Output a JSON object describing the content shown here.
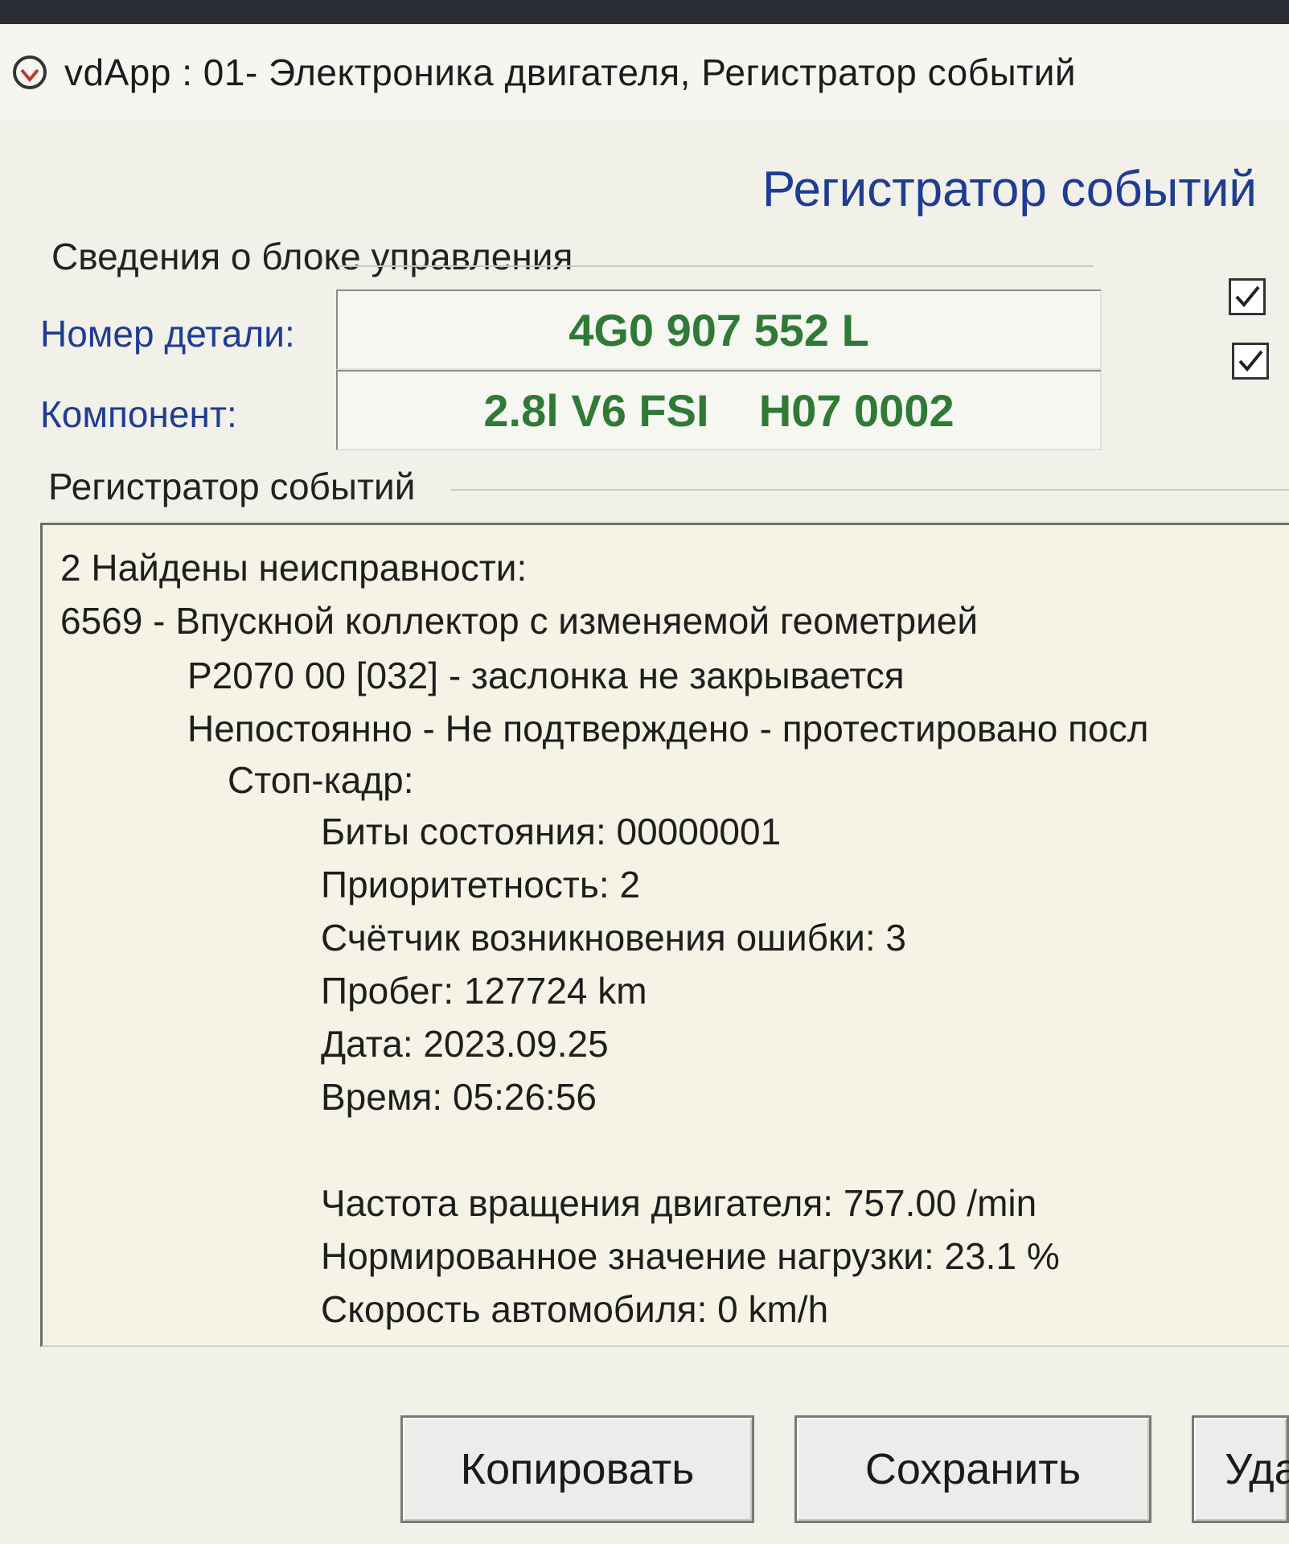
{
  "titlebar": {
    "title": "vdApp : 01- Электроника двигателя,  Регистратор событий"
  },
  "header": {
    "title": "Регистратор событий"
  },
  "ecu_info": {
    "group_title": "Сведения о блоке управления",
    "part_number_label": "Номер детали:",
    "part_number_value": "4G0 907 552 L",
    "component_label": "Компонент:",
    "component_value": "2.8l V6 FSI    H07 0002",
    "checkbox_1_checked": true,
    "checkbox_2_checked": true
  },
  "log": {
    "group_title": "Регистратор событий",
    "lines": [
      "2 Найдены неисправности:",
      "6569 - Впускной коллектор с изменяемой геометрией",
      "P2070 00 [032] - заслонка не закрывается",
      "Непостоянно - Не подтверждено - протестировано посл",
      "Стоп-кадр:",
      "Биты состояния: 00000001",
      "Приоритетность: 2",
      "Счётчик возникновения ошибки: 3",
      "Пробег: 127724 km",
      "Дата: 2023.09.25",
      "Время: 05:26:56",
      "Частота вращения двигателя: 757.00 /min",
      "Нормированное значение нагрузки: 23.1 %",
      "Скорость автомобиля: 0 km/h"
    ]
  },
  "buttons": {
    "copy": "Копировать",
    "save": "Сохранить",
    "delete": "Уда"
  }
}
